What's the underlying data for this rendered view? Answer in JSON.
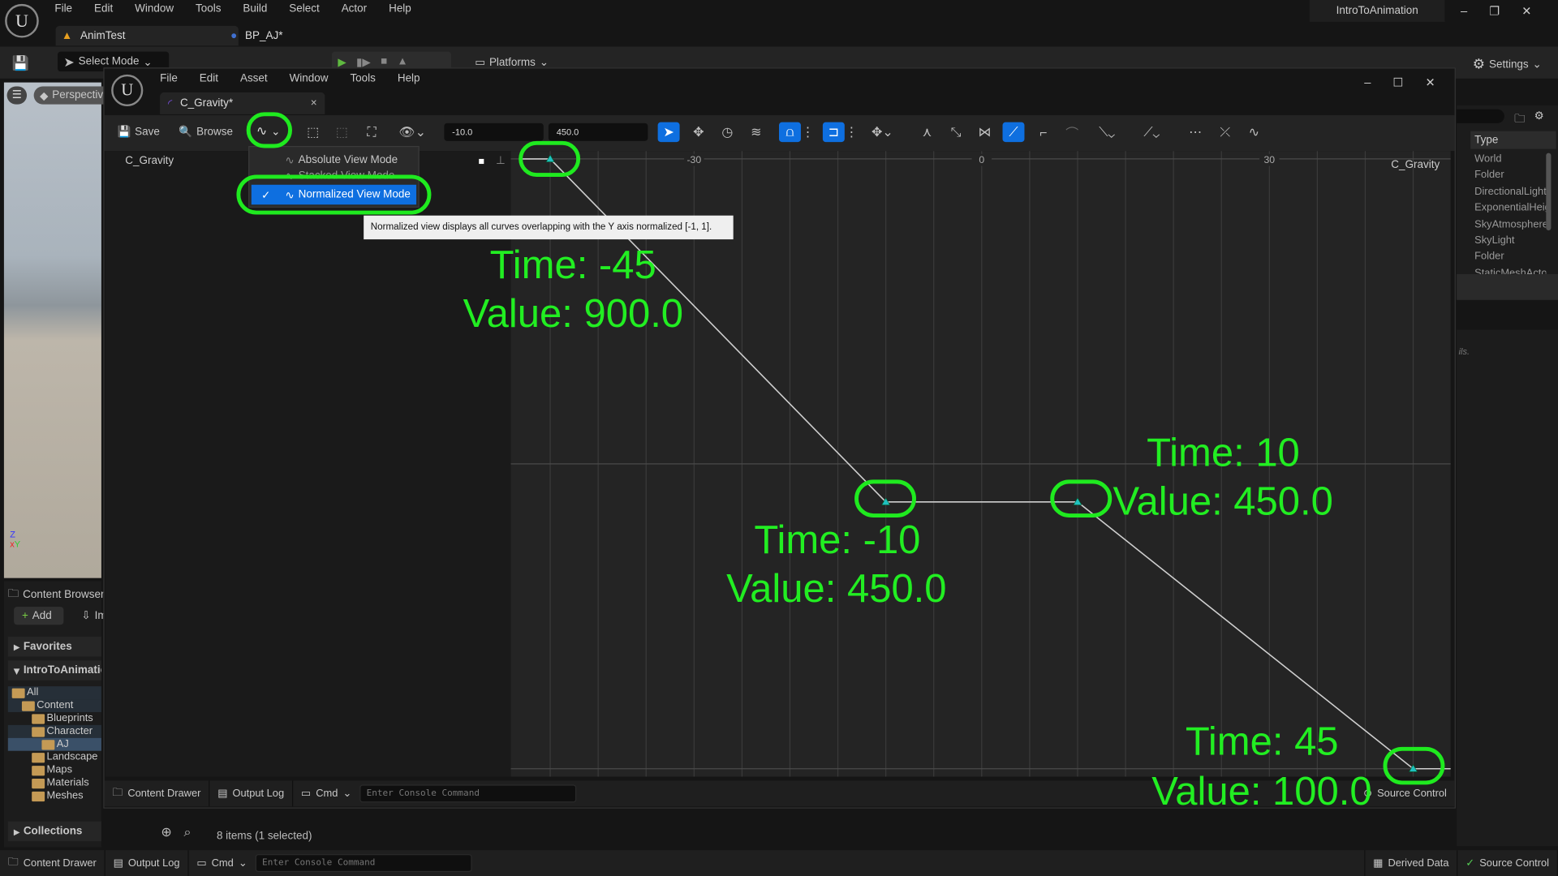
{
  "main_menu": [
    "File",
    "Edit",
    "Window",
    "Tools",
    "Build",
    "Select",
    "Actor",
    "Help"
  ],
  "project_name": "IntroToAnimation",
  "level_tabs": [
    {
      "label": "AnimTest",
      "icon": "level-icon"
    },
    {
      "label": "BP_AJ*",
      "icon": "blueprint-icon"
    }
  ],
  "main_toolbar": {
    "select_mode": "Select Mode",
    "platforms": "Platforms",
    "settings": "Settings"
  },
  "viewport": {
    "perspective": "Perspective"
  },
  "content_browser": {
    "title": "Content Browser",
    "add": "Add",
    "import": "Im",
    "favorites": "Favorites",
    "project": "IntroToAnimation",
    "collections": "Collections",
    "items_status": "8 items (1 selected)",
    "tree": [
      {
        "label": "All",
        "depth": 0,
        "expanded": true
      },
      {
        "label": "Content",
        "depth": 1,
        "expanded": true
      },
      {
        "label": "Blueprints",
        "depth": 2
      },
      {
        "label": "Character",
        "depth": 2,
        "expanded": true
      },
      {
        "label": "AJ",
        "depth": 3,
        "selected": true
      },
      {
        "label": "Landscape",
        "depth": 2
      },
      {
        "label": "Maps",
        "depth": 2
      },
      {
        "label": "Materials",
        "depth": 2
      },
      {
        "label": "Meshes",
        "depth": 2
      }
    ]
  },
  "outliner": {
    "column": "Type",
    "rows": [
      "World",
      "Folder",
      "DirectionalLight",
      "ExponentialHeightFog",
      "SkyAtmosphere",
      "SkyLight",
      "Folder",
      "StaticMeshActor"
    ],
    "details_hint": "ils."
  },
  "curve_editor": {
    "menu": [
      "File",
      "Edit",
      "Asset",
      "Window",
      "Tools",
      "Help"
    ],
    "tab": "C_Gravity*",
    "toolbar": {
      "save": "Save",
      "browse": "Browse",
      "time_value": "-10.0",
      "key_value": "450.0"
    },
    "curve_name": "C_Gravity",
    "view_mode_menu": [
      {
        "label": "Absolute View Mode",
        "checked": false
      },
      {
        "label": "Stacked View Mode",
        "checked": false
      },
      {
        "label": "Normalized View Mode",
        "checked": true
      }
    ],
    "tooltip": "Normalized view displays all curves overlapping with the Y axis normalized [-1, 1].",
    "graph_label": "C_Gravity",
    "x_ticks": [
      "-30",
      "0",
      "30"
    ],
    "keys": [
      {
        "time": -45,
        "value": 900.0
      },
      {
        "time": -10,
        "value": 450.0
      },
      {
        "time": 10,
        "value": 450.0
      },
      {
        "time": 45,
        "value": 100.0
      }
    ],
    "accent": "#0e6fe0"
  },
  "annotations": [
    {
      "time": "Time: -45",
      "value": "Value: 900.0"
    },
    {
      "time": "Time: -10",
      "value": "Value: 450.0"
    },
    {
      "time": "Time: 10",
      "value": "Value: 450.0"
    },
    {
      "time": "Time: 45",
      "value": "Value: 100.0"
    }
  ],
  "annotation_color": "#22ee22",
  "status_bar": {
    "content_drawer": "Content Drawer",
    "output_log": "Output Log",
    "cmd": "Cmd",
    "console_placeholder": "Enter Console Command",
    "derived_data": "Derived Data",
    "source_control": "Source Control"
  }
}
